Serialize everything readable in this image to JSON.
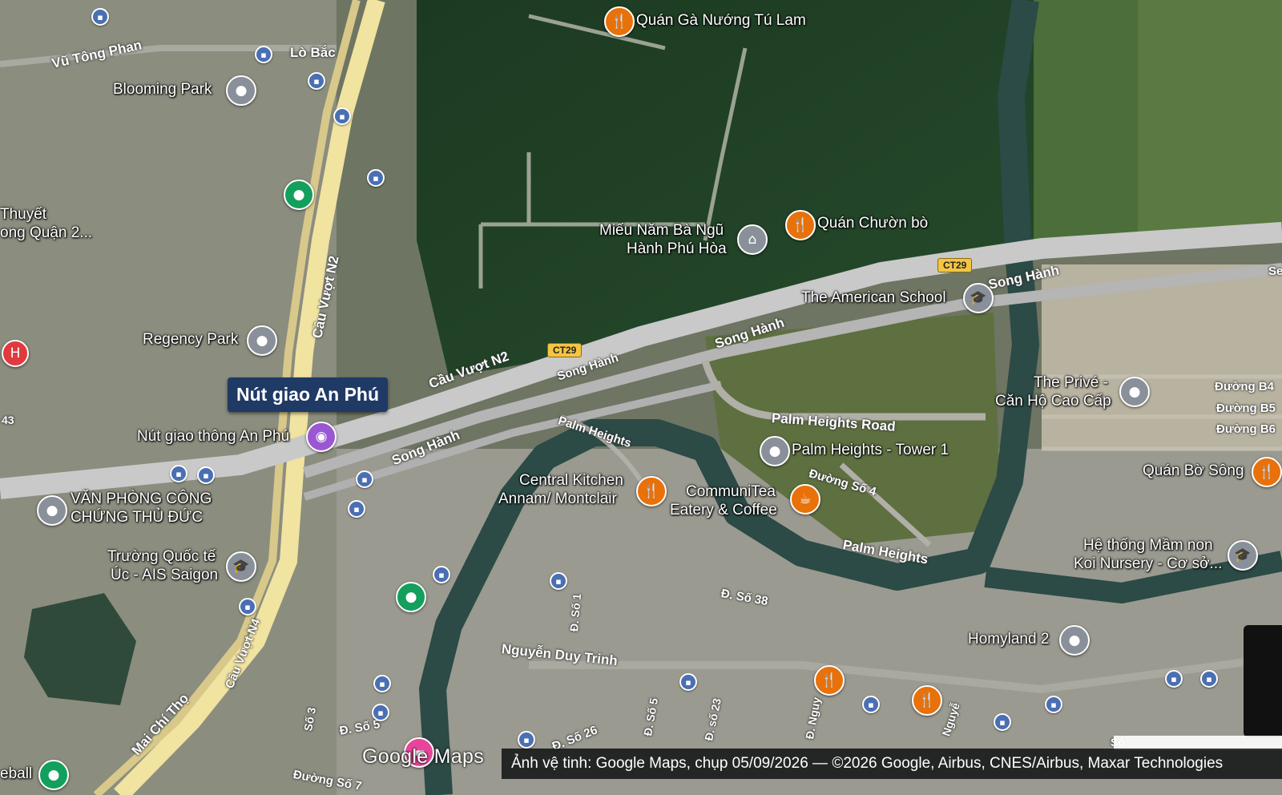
{
  "map": {
    "type": "satellite",
    "callout_label": "Nút giao An Phú",
    "wordmark": "Google Maps",
    "caption": "Ảnh vệ tinh: Google Maps, chụp 05/09/2026 — ©2026 Google, Airbus, CNES/Airbus, Maxar Technologies"
  },
  "places": [
    {
      "name": "Quán Gà Nướng Tú Lam",
      "icon": "restaurant-icon"
    },
    {
      "name": "Blooming Park",
      "icon": "place-icon"
    },
    {
      "name": "Miếu Năm Bà Ngũ Hành Phú Hòa",
      "line1": "Miếu Năm Bà Ngũ",
      "line2": "Hành Phú Hòa",
      "icon": "temple-icon"
    },
    {
      "name": "Quán Chườn bò",
      "icon": "restaurant-icon"
    },
    {
      "name": "The American School",
      "icon": "school-icon"
    },
    {
      "name": "Regency Park",
      "icon": "place-icon"
    },
    {
      "name": "Nút giao thông An Phú",
      "icon": "camera-icon"
    },
    {
      "name": "VĂN PHÒNG CÔNG CHỨNG THỦ ĐỨC",
      "line1": "VĂN PHÒNG CÔNG",
      "line2": "CHỨNG THỦ ĐỨC",
      "icon": "place-icon"
    },
    {
      "name": "Trường Quốc tế Úc - AIS Saigon",
      "line1": "Trường Quốc tế",
      "line2": "Úc - AIS Saigon",
      "icon": "school-icon"
    },
    {
      "name": "Central Kitchen Annam/ Montclair",
      "line1": "Central Kitchen",
      "line2": "Annam/ Montclair",
      "icon": "restaurant-icon"
    },
    {
      "name": "CommuniTea Eatery & Coffee",
      "line1": "CommuniTea",
      "line2": "Eatery & Coffee",
      "icon": "coffee-icon"
    },
    {
      "name": "Palm Heights - Tower 1",
      "icon": "place-icon"
    },
    {
      "name": "The Privé - Căn Hộ Cao Cấp",
      "line1": "The Privé -",
      "line2": "Căn Hộ Cao Cấp",
      "icon": "place-icon"
    },
    {
      "name": "Quán Bờ Sông",
      "icon": "restaurant-icon"
    },
    {
      "name": "Hệ thống Mầm non Koi Nursery - Cơ sở...",
      "line1": "Hệ thống Mầm non",
      "line2": "Koi Nursery - Cơ sở...",
      "icon": "school-icon"
    },
    {
      "name": "Homyland 2",
      "icon": "place-icon"
    },
    {
      "name": "Thuyết ong Quận 2...",
      "line1": "Thuyết",
      "line2": "ong Quận 2..."
    },
    {
      "name": "eball"
    }
  ],
  "roads": {
    "vu_tong_phan": "Vũ Tông Phan",
    "lo_bac": "Lò Bắc",
    "cau_vuot_n2_v": "Cầu Vượt N2",
    "cau_vuot_n2_h": "Cầu Vượt N2",
    "song_hanh_1": "Song Hành",
    "song_hanh_2": "Song Hành",
    "song_hanh_3": "Song Hành",
    "song_hanh_4": "Song Hành",
    "palm_heights": "Palm Heights",
    "palm_heights_road": "Palm Heights Road",
    "palm_heights_2": "Palm Heights",
    "duong_so_4": "Đường Số 4",
    "duong_b4": "Đường B4",
    "duong_b5": "Đường B5",
    "duong_b6": "Đường B6",
    "d_so_38": "Đ. Số 38",
    "nguyen_duy_trinh": "Nguyễn Duy Trinh",
    "cau_vuot_n4": "Cầu Vượt N4",
    "mai_chi_tho": "Mai Chí Thọ",
    "so_3": "Số 3",
    "d_so_5": "Đ. Số 5",
    "duong_so_7": "Đường Số 7",
    "d_so_26": "Đ. Số 26",
    "d_so_1": "Đ. Số 1",
    "d_so_5b": "Đ. Số 5",
    "d_so_23": "Đ. số 23",
    "d_nguy": "Đ. Nguy",
    "nguye": "Nguyễ",
    "n43": "43",
    "so": "Số",
    "se": "Se"
  },
  "shields": {
    "ct29_a": "CT29",
    "ct29_b": "CT29"
  },
  "colors": {
    "callout_bg": "#1f3a64",
    "restaurant_pin": "#e8710a",
    "green_pin": "#12a05c",
    "poi_pin": "#8a9099",
    "highway_fill": "#f1e3a0",
    "road_fill": "#c9c9c9"
  }
}
